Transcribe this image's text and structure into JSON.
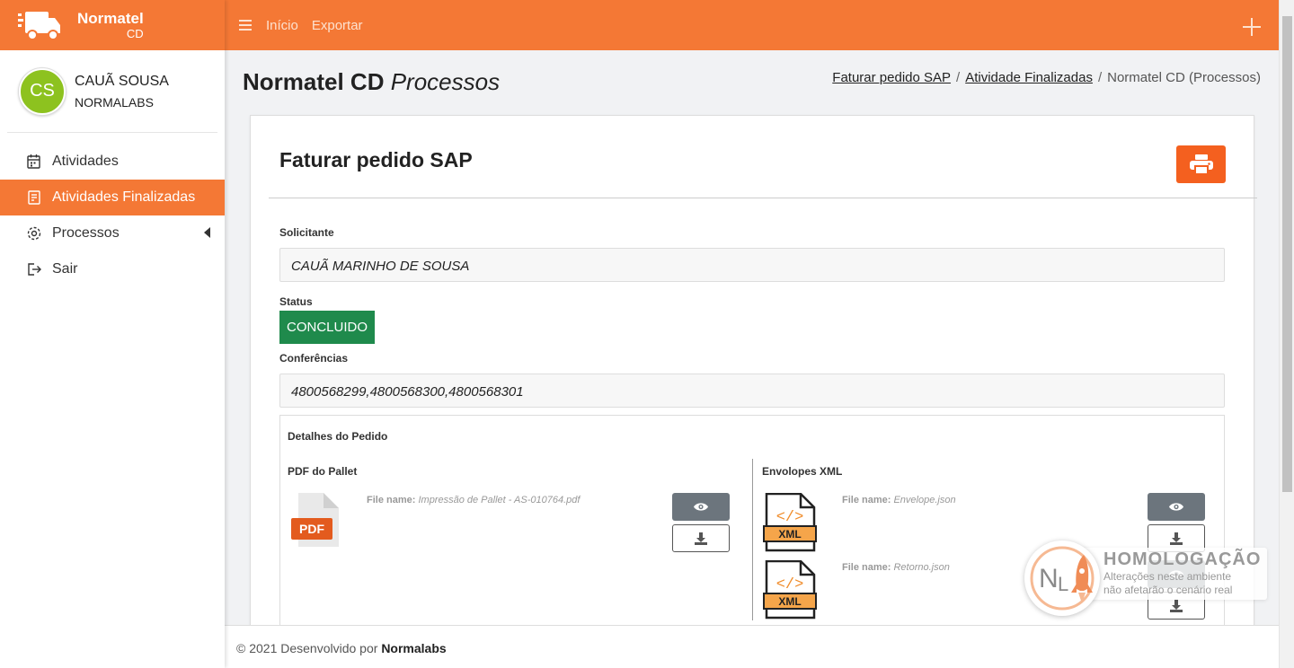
{
  "brand": {
    "name": "Normatel",
    "sub": "CD"
  },
  "user": {
    "initials": "CS",
    "name": "CAUÃ SOUSA",
    "org": "NORMALABS"
  },
  "sidebar": {
    "items": [
      {
        "label": "Atividades"
      },
      {
        "label": "Atividades Finalizadas"
      },
      {
        "label": "Processos"
      },
      {
        "label": "Sair"
      }
    ]
  },
  "topbar": {
    "links": [
      "Início",
      "Exportar"
    ]
  },
  "page": {
    "title": "Normatel CD",
    "title_sub": "Processos",
    "breadcrumb": [
      "Faturar pedido SAP",
      "Atividade Finalizadas",
      "Normatel CD (Processos)"
    ],
    "breadcrumb_sep": "/"
  },
  "card": {
    "title": "Faturar pedido SAP",
    "solicitante_label": "Solicitante",
    "solicitante_value": "CAUÃ MARINHO DE SOUSA",
    "status_label": "Status",
    "status_value": "CONCLUIDO",
    "conferencias_label": "Conferências",
    "conferencias_value": "4800568299,4800568300,4800568301",
    "details_title": "Detalhes do Pedido",
    "pdf_col_title": "PDF do Pallet",
    "xml_col_title": "Envolopes XML",
    "file_name_label": "File name:",
    "pdf_file": "Impressão de Pallet - AS-010764.pdf",
    "pdf_icon_text": "PDF",
    "xml_icon_text": "XML",
    "xml_files": [
      "Envelope.json",
      "Retorno.json"
    ]
  },
  "footer": {
    "text": "© 2021 Desenvolvido por",
    "company": "Normalabs"
  },
  "homolog": {
    "title": "HOMOLOGAÇÃO",
    "line1": "Alterações neste ambiente",
    "line2": "não afetarão o cenário real"
  },
  "colors": {
    "primary": "#f47835",
    "success": "#1f8a4c",
    "print": "#f4601f"
  }
}
